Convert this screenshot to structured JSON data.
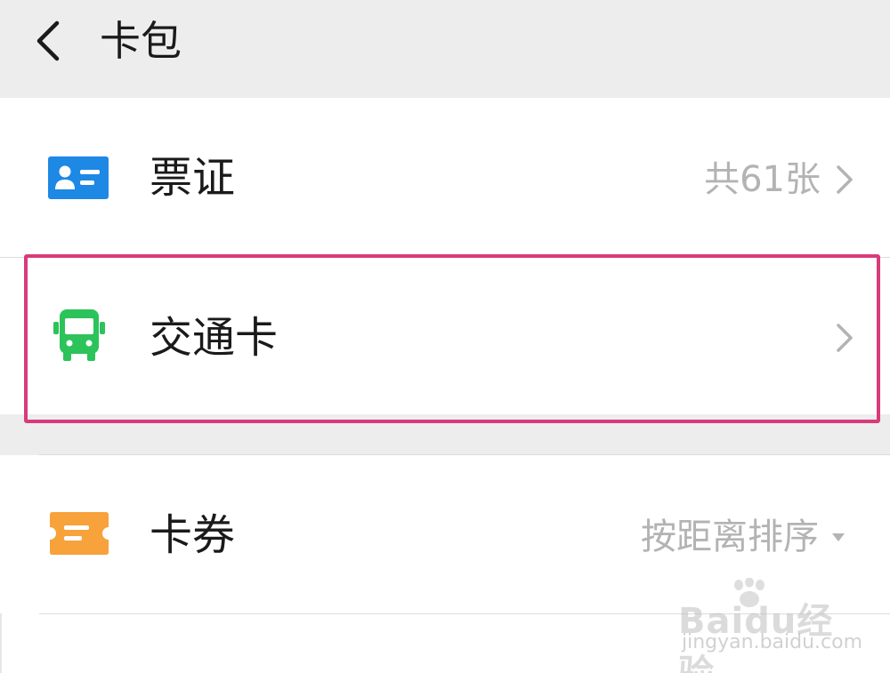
{
  "header": {
    "title": "卡包"
  },
  "rows": [
    {
      "label": "票证",
      "value": "共61张",
      "icon": "id-card-icon",
      "icon_color": "#1e88e5"
    },
    {
      "label": "交通卡",
      "value": "",
      "icon": "bus-icon",
      "icon_color": "#2bc35a"
    },
    {
      "label": "卡券",
      "value": "按距离排序",
      "icon": "ticket-icon",
      "icon_color": "#f7a23b"
    }
  ],
  "highlight_color": "#d93b7a",
  "watermark": {
    "logo": "Baidu经验",
    "url": "jingyan.baidu.com"
  }
}
